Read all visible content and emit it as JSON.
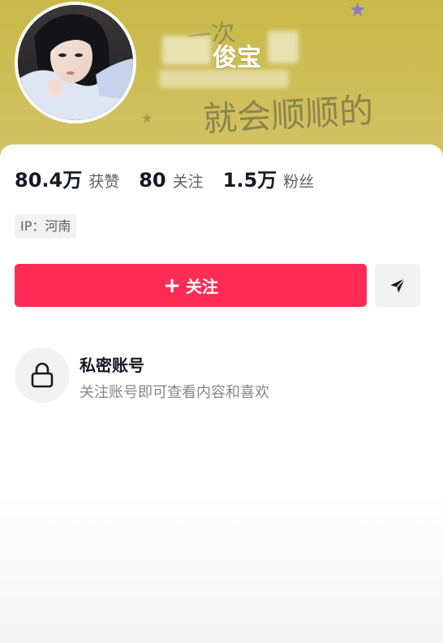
{
  "profile": {
    "nickname": "俊宝",
    "banner_text_top": "一次",
    "banner_text_bottom": "就会顺顺的"
  },
  "stats": [
    {
      "value": "80.4万",
      "label": "获赞"
    },
    {
      "value": "80",
      "label": "关注"
    },
    {
      "value": "1.5万",
      "label": "粉丝"
    }
  ],
  "ip": "IP：河南",
  "actions": {
    "follow_icon": "+",
    "follow_label": "关注",
    "share_icon": "send-icon"
  },
  "private_account": {
    "title": "私密账号",
    "description": "关注账号即可查看内容和喜欢",
    "icon": "lock-icon"
  },
  "colors": {
    "accent": "#fe2c55",
    "banner": "#cdbd55"
  }
}
